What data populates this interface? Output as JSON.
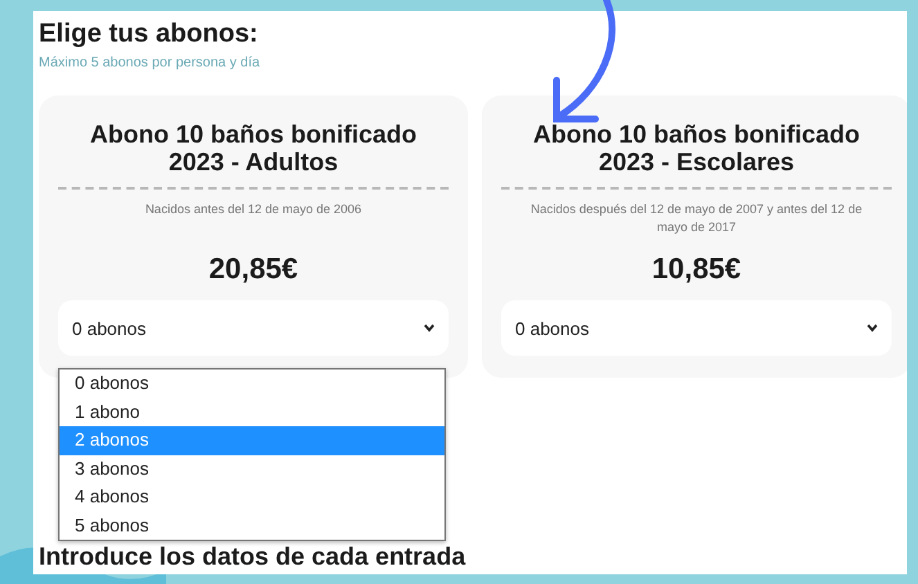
{
  "heading": "Elige tus abonos:",
  "subtitle": "Máximo 5 abonos por persona y día",
  "cards": [
    {
      "title": "Abono 10 baños bonificado 2023 - Adultos",
      "note": "Nacidos antes del 12 de mayo de 2006",
      "price": "20,85€",
      "select": {
        "value": "0 abonos",
        "open": true,
        "options": [
          {
            "label": "0 abonos",
            "highlighted": false
          },
          {
            "label": "1 abono",
            "highlighted": false
          },
          {
            "label": "2 abonos",
            "highlighted": true
          },
          {
            "label": "3 abonos",
            "highlighted": false
          },
          {
            "label": "4 abonos",
            "highlighted": false
          },
          {
            "label": "5 abonos",
            "highlighted": false
          }
        ]
      }
    },
    {
      "title": "Abono 10 baños bonificado 2023 - Escolares",
      "note": "Nacidos después del 12 de mayo de 2007 y antes del 12 de mayo de 2017",
      "price": "10,85€",
      "select": {
        "value": "0 abonos"
      }
    }
  ],
  "section_heading": "Introduce los datos de cada entrada"
}
